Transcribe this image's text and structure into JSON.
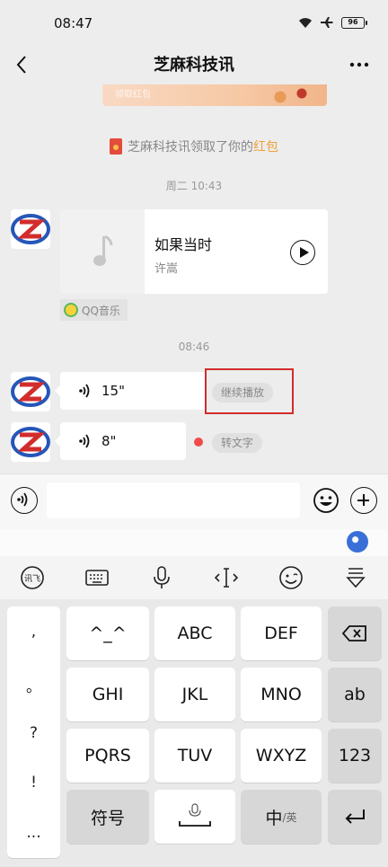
{
  "status": {
    "time": "08:47",
    "battery": "96"
  },
  "header": {
    "title": "芝麻科技讯"
  },
  "banner": {
    "text": "领取红包"
  },
  "notice": {
    "prefix": "芝麻科技讯领取了你的",
    "highlight": "红包"
  },
  "messages": {
    "timestamp1": "周二 10:43",
    "music": {
      "title": "如果当时",
      "artist": "许嵩",
      "source": "QQ音乐"
    },
    "timestamp2": "08:46",
    "voice1": {
      "duration": "15\"",
      "action": "继续播放"
    },
    "voice2": {
      "duration": "8\"",
      "action": "转文字"
    }
  },
  "input": {
    "placeholder": ""
  },
  "keyboard": {
    "punctuation": [
      ",",
      "。",
      "?",
      "!",
      "..."
    ],
    "rows": [
      [
        "^_^",
        "ABC",
        "DEF"
      ],
      [
        "GHI",
        "JKL",
        "MNO"
      ],
      [
        "PQRS",
        "TUV",
        "WXYZ"
      ]
    ],
    "fn": {
      "ab": "ab",
      "num": "123",
      "symbols": "符号",
      "lang_main": "中",
      "lang_sub": "/英"
    }
  },
  "colors": {
    "accent": "#f0a03a",
    "highlight": "#d22c2c",
    "unread": "#f04a4a"
  }
}
